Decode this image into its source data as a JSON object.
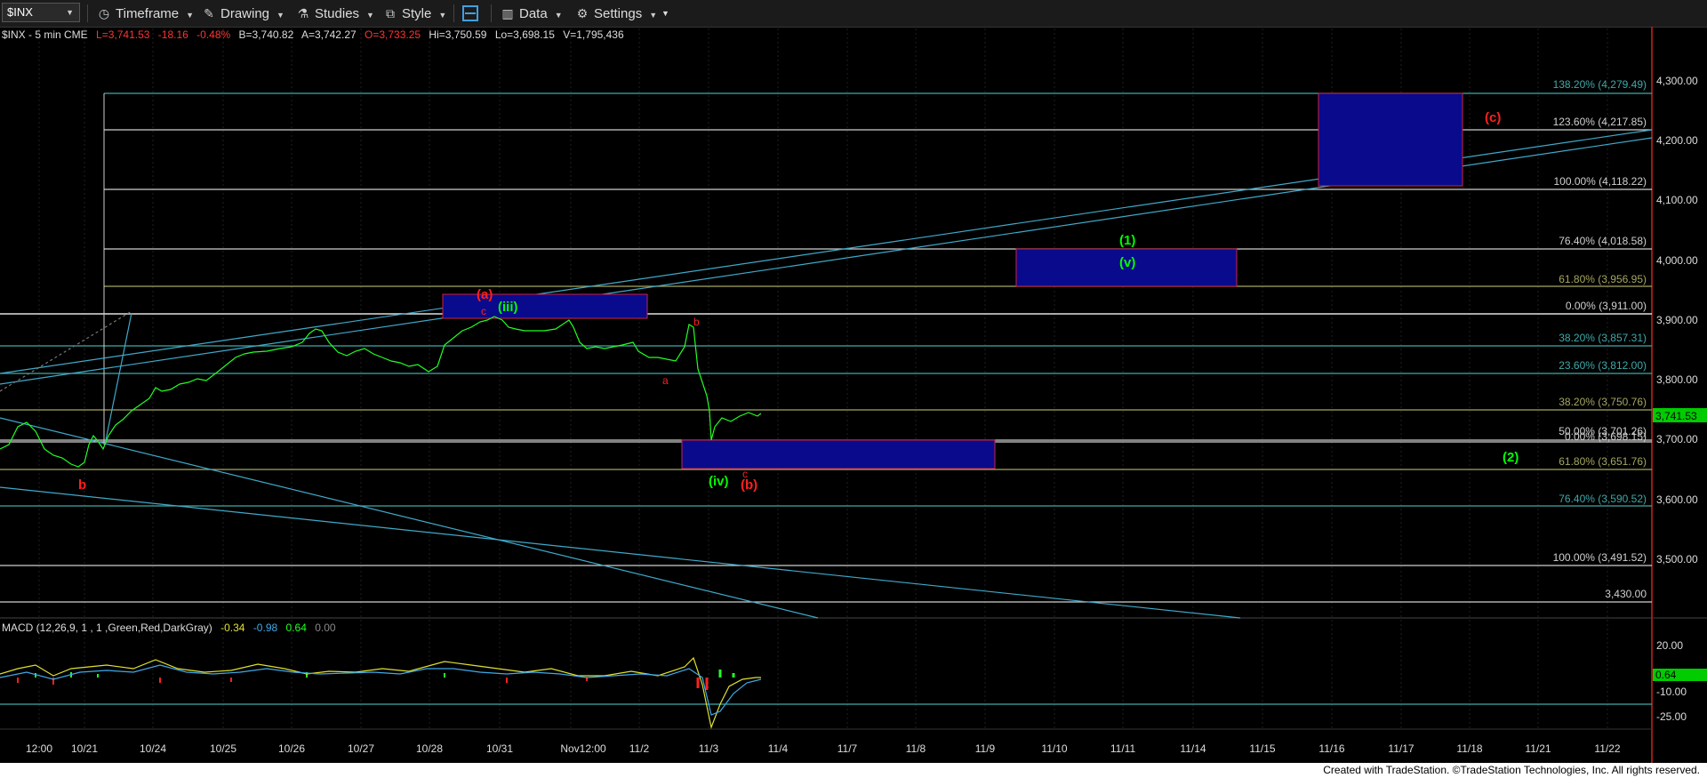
{
  "toolbar": {
    "symbol": "$INX",
    "timeframe_label": "Timeframe",
    "drawing_label": "Drawing",
    "studies_label": "Studies",
    "style_label": "Style",
    "data_label": "Data",
    "settings_label": "Settings"
  },
  "quote": {
    "symbol_info": "$INX - 5 min  CME",
    "last": "L=3,741.53",
    "change": "-18.16",
    "change_pct": "-0.48%",
    "bid": "B=3,740.82",
    "ask": "A=3,742.27",
    "open": "O=3,733.25",
    "high": "Hi=3,750.59",
    "low": "Lo=3,698.15",
    "volume": "V=1,795,436",
    "last_price_tag": "3,741.53"
  },
  "price_axis": [
    "4,300.00",
    "4,200.00",
    "4,100.00",
    "4,000.00",
    "3,900.00",
    "3,800.00",
    "3,700.00",
    "3,600.00",
    "3,500.00"
  ],
  "fib_levels": [
    {
      "label": "138.20% (4,279.49)",
      "color": "#3fa9a9"
    },
    {
      "label": "123.60% (4,217.85)",
      "color": "#d0d0d0"
    },
    {
      "label": "100.00% (4,118.22)",
      "color": "#d0d0d0"
    },
    {
      "label": "76.40% (4,018.58)",
      "color": "#d0d0d0"
    },
    {
      "label": "61.80% (3,956.95)",
      "color": "#a6a660"
    },
    {
      "label": "0.00% (3,911.00)",
      "color": "#d0d0d0"
    },
    {
      "label": "38.20% (3,857.31)",
      "color": "#3fa9a9"
    },
    {
      "label": "23.60% (3,812.00)",
      "color": "#3fa9a9"
    },
    {
      "label": "38.20% (3,750.76)",
      "color": "#a6a660"
    },
    {
      "label": "50.00% (3,701.26)",
      "color": "#d0d0d0"
    },
    {
      "label": "0.00% (3,698.15)",
      "color": "#d0d0d0"
    },
    {
      "label": "61.80% (3,651.76)",
      "color": "#a6a660"
    },
    {
      "label": "76.40% (3,590.52)",
      "color": "#3fa9a9"
    },
    {
      "label": "100.00% (3,491.52)",
      "color": "#d0d0d0"
    },
    {
      "label": "3,430.00",
      "color": "#d0d0d0"
    }
  ],
  "wave_labels": {
    "c_red": "(c)",
    "one_green": "(1)",
    "v_green": "(v)",
    "a_red": "(a)",
    "iii_green": "(iii)",
    "c_small": "c",
    "b_small": "b",
    "a_small": "a",
    "iv_green": "(iv)",
    "c_small2": "c",
    "b_red": "(b)",
    "two_green": "(2)",
    "b_left": "b"
  },
  "macd": {
    "label": "MACD (12,26,9, 1 , 1 ,Green,Red,DarkGray)",
    "v1": "-0.34",
    "v2": "-0.98",
    "v3": "0.64",
    "v4": "0.00",
    "axis": [
      "20.00",
      "-10.00",
      "-25.00"
    ],
    "tag": "0.64"
  },
  "time_axis": [
    "12:00",
    "10/21",
    "10/24",
    "10/25",
    "10/26",
    "10/27",
    "10/28",
    "10/31",
    "Nov12:00",
    "11/2",
    "11/3",
    "11/4",
    "11/7",
    "11/8",
    "11/9",
    "11/10",
    "11/11",
    "11/14",
    "11/15",
    "11/16",
    "11/17",
    "11/18",
    "11/21",
    "11/22"
  ],
  "footer_text": "Created with TradeStation. ©TradeStation Technologies, Inc. All rights reserved.",
  "colors": {
    "accent_green": "#00ff00",
    "red": "#ff2020",
    "box_fill": "#0a0a8c",
    "box_border": "#cc2244",
    "line_cyan": "#3fa9c9"
  }
}
